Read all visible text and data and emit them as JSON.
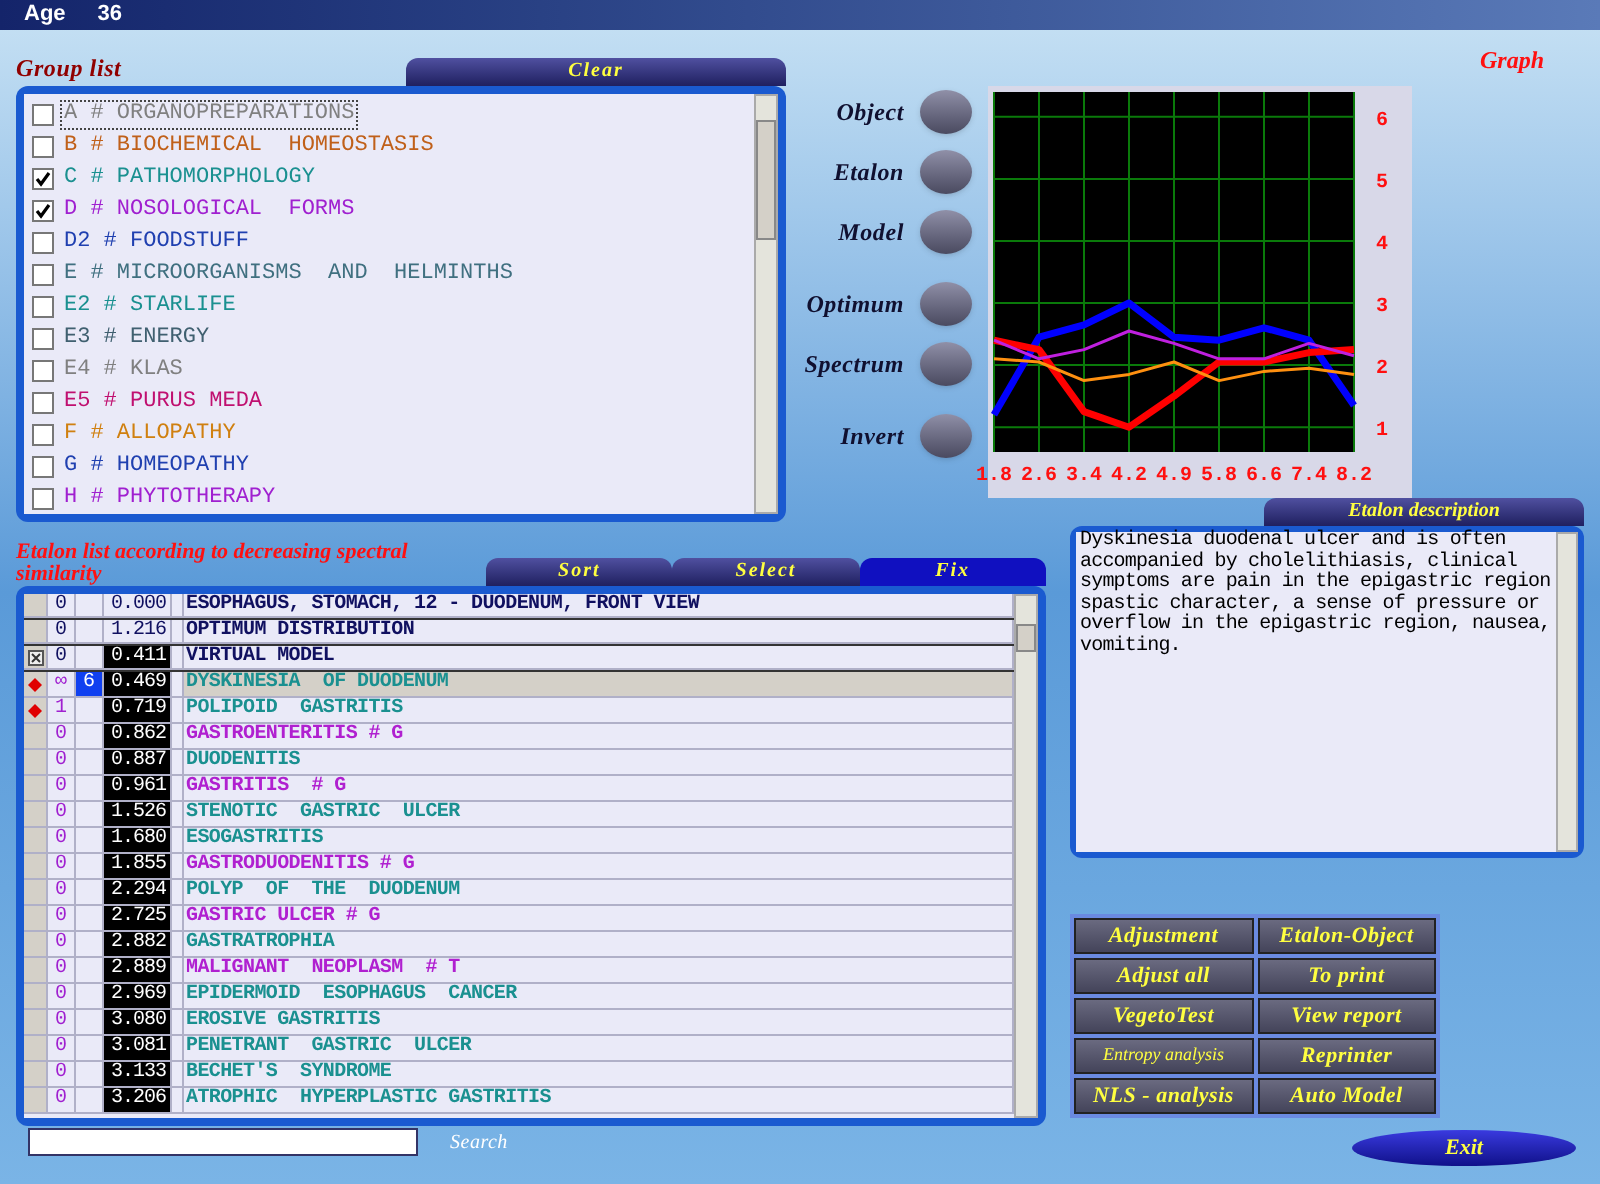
{
  "header": {
    "label": "Age",
    "value": "36"
  },
  "group_list": {
    "title": "Group list",
    "clear_button": "Clear",
    "items": [
      {
        "label": "A # ORGANOPREPARATIONS",
        "checked": false,
        "focused": true,
        "color": "#808080"
      },
      {
        "label": "B # BIOCHEMICAL  HOMEOSTASIS",
        "checked": false,
        "focused": false,
        "color": "#c0601a"
      },
      {
        "label": "C # PATHOMORPHOLOGY",
        "checked": true,
        "focused": false,
        "color": "#1a9090"
      },
      {
        "label": "D # NOSOLOGICAL  FORMS",
        "checked": true,
        "focused": false,
        "color": "#a020d0"
      },
      {
        "label": "D2 # FOODSTUFF",
        "checked": false,
        "focused": false,
        "color": "#2040b0"
      },
      {
        "label": "E # MICROORGANISMS  AND  HELMINTHS",
        "checked": false,
        "focused": false,
        "color": "#407080"
      },
      {
        "label": "E2 # STARLIFE",
        "checked": false,
        "focused": false,
        "color": "#1a9090"
      },
      {
        "label": "E3 # ENERGY",
        "checked": false,
        "focused": false,
        "color": "#406070"
      },
      {
        "label": "E4 # KLAS",
        "checked": false,
        "focused": false,
        "color": "#808080"
      },
      {
        "label": "E5 # PURUS MEDA",
        "checked": false,
        "focused": false,
        "color": "#c01070"
      },
      {
        "label": "F # ALLOPATHY",
        "checked": false,
        "focused": false,
        "color": "#d08010"
      },
      {
        "label": "G # HOMEOPATHY",
        "checked": false,
        "focused": false,
        "color": "#2040b0"
      },
      {
        "label": "H # PHYTOTHERAPY",
        "checked": false,
        "focused": false,
        "color": "#a020d0"
      }
    ]
  },
  "graph": {
    "title": "Graph",
    "toggles": [
      "Object",
      "Etalon",
      "Model",
      "Optimum",
      "Spectrum",
      "Invert"
    ],
    "chart_data": {
      "type": "line",
      "grid": true,
      "categories": [
        "1.8",
        "2.6",
        "3.4",
        "4.2",
        "4.9",
        "5.8",
        "6.6",
        "7.4",
        "8.2"
      ],
      "ylim": [
        0.6,
        6.4
      ],
      "yticks": [
        1,
        2,
        3,
        4,
        5,
        6
      ],
      "series": [
        {
          "color": "#0000ff",
          "values": [
            1.2,
            2.45,
            2.65,
            3.0,
            2.45,
            2.4,
            2.6,
            2.4,
            1.35
          ]
        },
        {
          "color": "#ff0000",
          "values": [
            2.4,
            2.25,
            1.25,
            1.0,
            1.5,
            2.05,
            2.05,
            2.2,
            2.25
          ]
        },
        {
          "color": "#c020e0",
          "values": [
            2.4,
            2.1,
            2.25,
            2.55,
            2.35,
            2.1,
            2.1,
            2.35,
            2.15
          ]
        },
        {
          "color": "#ff9010",
          "values": [
            2.1,
            2.05,
            1.75,
            1.85,
            2.05,
            1.75,
            1.9,
            1.95,
            1.85
          ]
        }
      ]
    }
  },
  "etalon_list": {
    "title": "Etalon list according to decreasing spectral similarity",
    "tabs": [
      {
        "label": "Sort",
        "selected": false
      },
      {
        "label": "Select",
        "selected": false
      },
      {
        "label": "Fix",
        "selected": true
      }
    ],
    "rows": [
      {
        "kind": "reference",
        "excluded": false,
        "pinned": false,
        "count": "0",
        "value": "0.000",
        "name": "ESOPHAGUS, STOMACH, 12 - DUODENUM, FRONT VIEW",
        "color": "#101060",
        "selected": false
      },
      {
        "kind": "reference",
        "excluded": false,
        "pinned": false,
        "count": "0",
        "value": "1.216",
        "name": "OPTIMUM DISTRIBUTION",
        "color": "#101060",
        "selected": false
      },
      {
        "kind": "reference",
        "excluded": true,
        "pinned": false,
        "count": "0",
        "value": "0.411",
        "name": "VIRTUAL MODEL",
        "color": "#101060",
        "selected": false
      },
      {
        "kind": "etalon",
        "excluded": false,
        "pinned": true,
        "count": "∞",
        "badge": "6",
        "value": "0.469",
        "name": "DYSKINESIA  OF DUODENUM",
        "color": "#1a9090",
        "selected": true
      },
      {
        "kind": "etalon",
        "excluded": false,
        "pinned": true,
        "count": "1",
        "value": "0.719",
        "name": "POLIPOID  GASTRITIS",
        "color": "#1a9090",
        "selected": false
      },
      {
        "kind": "etalon",
        "excluded": false,
        "pinned": false,
        "count": "0",
        "value": "0.862",
        "name": "GASTROENTERITIS # G",
        "color": "#b020d0",
        "selected": false
      },
      {
        "kind": "etalon",
        "excluded": false,
        "pinned": false,
        "count": "0",
        "value": "0.887",
        "name": "DUODENITIS",
        "color": "#1a9090",
        "selected": false
      },
      {
        "kind": "etalon",
        "excluded": false,
        "pinned": false,
        "count": "0",
        "value": "0.961",
        "name": "GASTRITIS  # G",
        "color": "#b020d0",
        "selected": false
      },
      {
        "kind": "etalon",
        "excluded": false,
        "pinned": false,
        "count": "0",
        "value": "1.526",
        "name": "STENOTIC  GASTRIC  ULCER",
        "color": "#1a9090",
        "selected": false
      },
      {
        "kind": "etalon",
        "excluded": false,
        "pinned": false,
        "count": "0",
        "value": "1.680",
        "name": "ESOGASTRITIS",
        "color": "#1a9090",
        "selected": false
      },
      {
        "kind": "etalon",
        "excluded": false,
        "pinned": false,
        "count": "0",
        "value": "1.855",
        "name": "GASTRODUODENITIS # G",
        "color": "#b020d0",
        "selected": false
      },
      {
        "kind": "etalon",
        "excluded": false,
        "pinned": false,
        "count": "0",
        "value": "2.294",
        "name": "POLYP  OF  THE  DUODENUM",
        "color": "#1a9090",
        "selected": false
      },
      {
        "kind": "etalon",
        "excluded": false,
        "pinned": false,
        "count": "0",
        "value": "2.725",
        "name": "GASTRIC ULCER # G",
        "color": "#b020d0",
        "selected": false
      },
      {
        "kind": "etalon",
        "excluded": false,
        "pinned": false,
        "count": "0",
        "value": "2.882",
        "name": "GASTRATROPHIA",
        "color": "#1a9090",
        "selected": false
      },
      {
        "kind": "etalon",
        "excluded": false,
        "pinned": false,
        "count": "0",
        "value": "2.889",
        "name": "MALIGNANT  NEOPLASM  # T",
        "color": "#b020d0",
        "selected": false
      },
      {
        "kind": "etalon",
        "excluded": false,
        "pinned": false,
        "count": "0",
        "value": "2.969",
        "name": "EPIDERMOID  ESOPHAGUS  CANCER",
        "color": "#1a9090",
        "selected": false
      },
      {
        "kind": "etalon",
        "excluded": false,
        "pinned": false,
        "count": "0",
        "value": "3.080",
        "name": "EROSIVE GASTRITIS",
        "color": "#1a9090",
        "selected": false
      },
      {
        "kind": "etalon",
        "excluded": false,
        "pinned": false,
        "count": "0",
        "value": "3.081",
        "name": "PENETRANT  GASTRIC  ULCER",
        "color": "#1a9090",
        "selected": false
      },
      {
        "kind": "etalon",
        "excluded": false,
        "pinned": false,
        "count": "0",
        "value": "3.133",
        "name": "BECHET'S  SYNDROME",
        "color": "#1a9090",
        "selected": false
      },
      {
        "kind": "etalon",
        "excluded": false,
        "pinned": false,
        "count": "0",
        "value": "3.206",
        "name": "ATROPHIC  HYPERPLASTIC GASTRITIS",
        "color": "#1a9090",
        "selected": false
      }
    ],
    "search_label": "Search"
  },
  "description": {
    "title": "Etalon description",
    "text": "Dyskinesia duodenal ulcer and is often accompanied by cholelithiasis, clinical symptoms are pain in the epigastric region spastic character, a sense of pressure or overflow in the epigastric region, nausea, vomiting."
  },
  "actions": [
    {
      "label": "Adjustment",
      "kind": "normal"
    },
    {
      "label": "Etalon-Object",
      "kind": "normal"
    },
    {
      "label": "Adjust all",
      "kind": "normal"
    },
    {
      "label": "To print",
      "kind": "normal"
    },
    {
      "label": "VegetoTest",
      "kind": "normal"
    },
    {
      "label": "View report",
      "kind": "normal"
    },
    {
      "label": "Entropy analysis",
      "kind": "small"
    },
    {
      "label": "Reprinter",
      "kind": "normal"
    },
    {
      "label": "NLS - analysis",
      "kind": "normal"
    },
    {
      "label": "Auto Model",
      "kind": "normal"
    }
  ],
  "exit_button": "Exit"
}
